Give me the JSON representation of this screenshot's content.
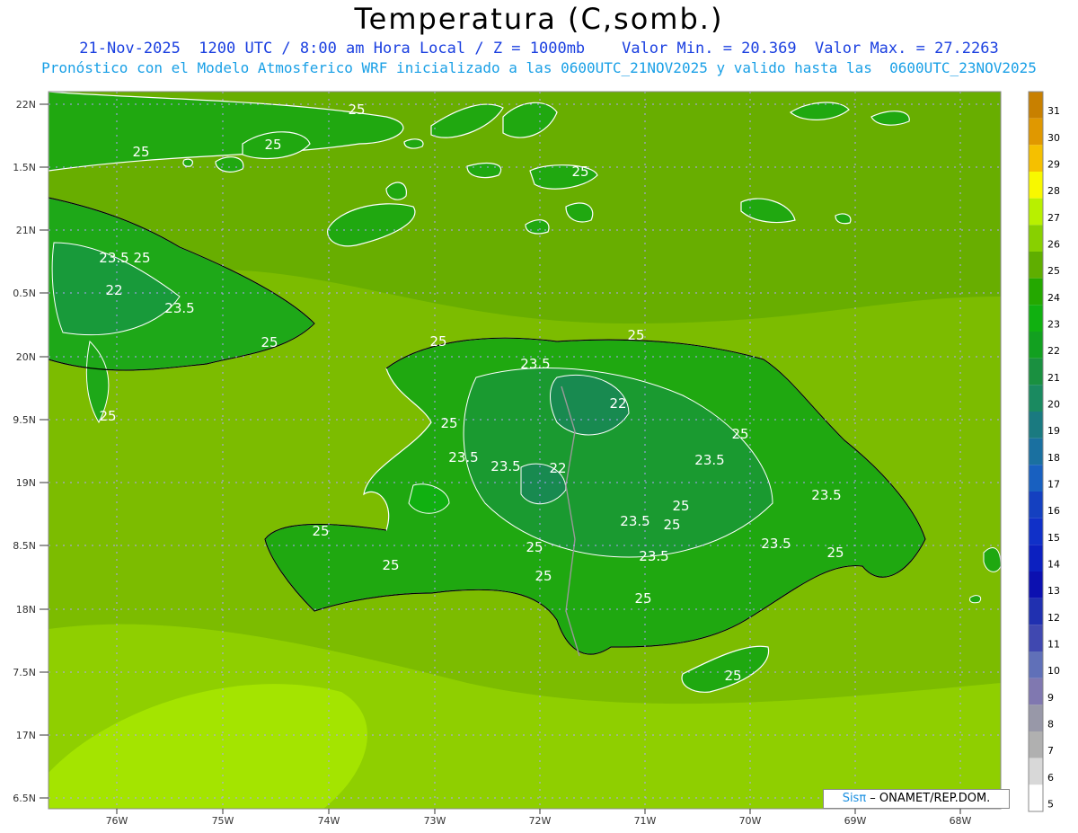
{
  "header": {
    "title": "Temperatura (C,somb.)",
    "line1": "21-Nov-2025  1200 UTC / 8:00 am Hora Local / Z = 1000mb    Valor Min. = 20.369  Valor Max. = 27.2263",
    "line2": "Pronóstico con el Modelo Atmosferico WRF inicializado a las 0600UTC_21NOV2025 y valido hasta las  0600UTC_23NOV2025"
  },
  "axes": {
    "lat_labels": [
      "22N",
      "1.5N",
      "21N",
      "0.5N",
      "20N",
      "9.5N",
      "19N",
      "8.5N",
      "18N",
      "7.5N",
      "17N",
      "6.5N"
    ],
    "lon_labels": [
      "76W",
      "75W",
      "74W",
      "73W",
      "72W",
      "71W",
      "70W",
      "69W",
      "68W"
    ]
  },
  "colorbar": {
    "labels": [
      "31",
      "30",
      "29",
      "28",
      "27",
      "26",
      "25",
      "24",
      "23",
      "22",
      "21",
      "20",
      "19",
      "18",
      "17",
      "16",
      "15",
      "14",
      "13",
      "12",
      "11",
      "10",
      "9",
      "8",
      "7",
      "6",
      "5"
    ],
    "colors": [
      "#c88000",
      "#e09800",
      "#f5c000",
      "#f8f800",
      "#b8f000",
      "#88d000",
      "#5fae00",
      "#24a800",
      "#10b010",
      "#12a020",
      "#1a9040",
      "#1a8a60",
      "#1a7a80",
      "#1a70a0",
      "#1860c0",
      "#1440c0",
      "#1030c8",
      "#0c20c0",
      "#0c10b0",
      "#2030b0",
      "#4048b0",
      "#6070b8",
      "#8078b0",
      "#9898a8",
      "#b0b0b0",
      "#d8d8d8",
      "#ffffff"
    ]
  },
  "contours": {
    "labels": [
      "25",
      "25",
      "25",
      "25",
      "25",
      "23.5",
      "25",
      "22",
      "23.5",
      "25",
      "25",
      "25",
      "25",
      "23.5",
      "22",
      "25",
      "23.5",
      "23.5",
      "22",
      "23.5",
      "23.5",
      "25",
      "25",
      "25",
      "23.5",
      "23.5",
      "25",
      "25",
      "25",
      "25",
      "23.5",
      "25",
      "25"
    ]
  },
  "credit": {
    "brand": "Sisπ",
    "text": " – ONAMET/REP.DOM."
  }
}
